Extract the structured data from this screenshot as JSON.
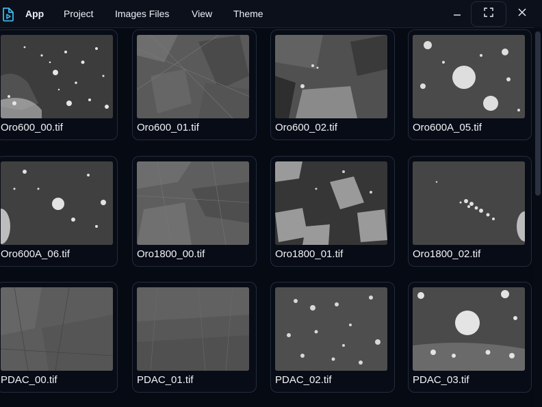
{
  "menubar": {
    "logo_icon": "app-file-logo-icon",
    "items": [
      {
        "label": "App"
      },
      {
        "label": "Project"
      },
      {
        "label": "Images Files"
      },
      {
        "label": "View"
      },
      {
        "label": "Theme"
      }
    ],
    "window_controls": {
      "minimize_icon": "minimize-icon",
      "maximize_icon": "maximize-icon",
      "close_icon": "close-icon"
    }
  },
  "images": [
    {
      "filename": "Oro600_00.tif"
    },
    {
      "filename": "Oro600_01.tif"
    },
    {
      "filename": "Oro600_02.tif"
    },
    {
      "filename": "Oro600A_05.tif"
    },
    {
      "filename": "Oro600A_06.tif"
    },
    {
      "filename": "Oro1800_00.tif"
    },
    {
      "filename": "Oro1800_01.tif"
    },
    {
      "filename": "Oro1800_02.tif"
    },
    {
      "filename": "PDAC_00.tif"
    },
    {
      "filename": "PDAC_01.tif"
    },
    {
      "filename": "PDAC_02.tif"
    },
    {
      "filename": "PDAC_03.tif"
    }
  ],
  "colors": {
    "background": "#060a13",
    "card_border": "#242c3c",
    "text": "#f1f3f7",
    "accent_logo": "#3fb8e8"
  }
}
